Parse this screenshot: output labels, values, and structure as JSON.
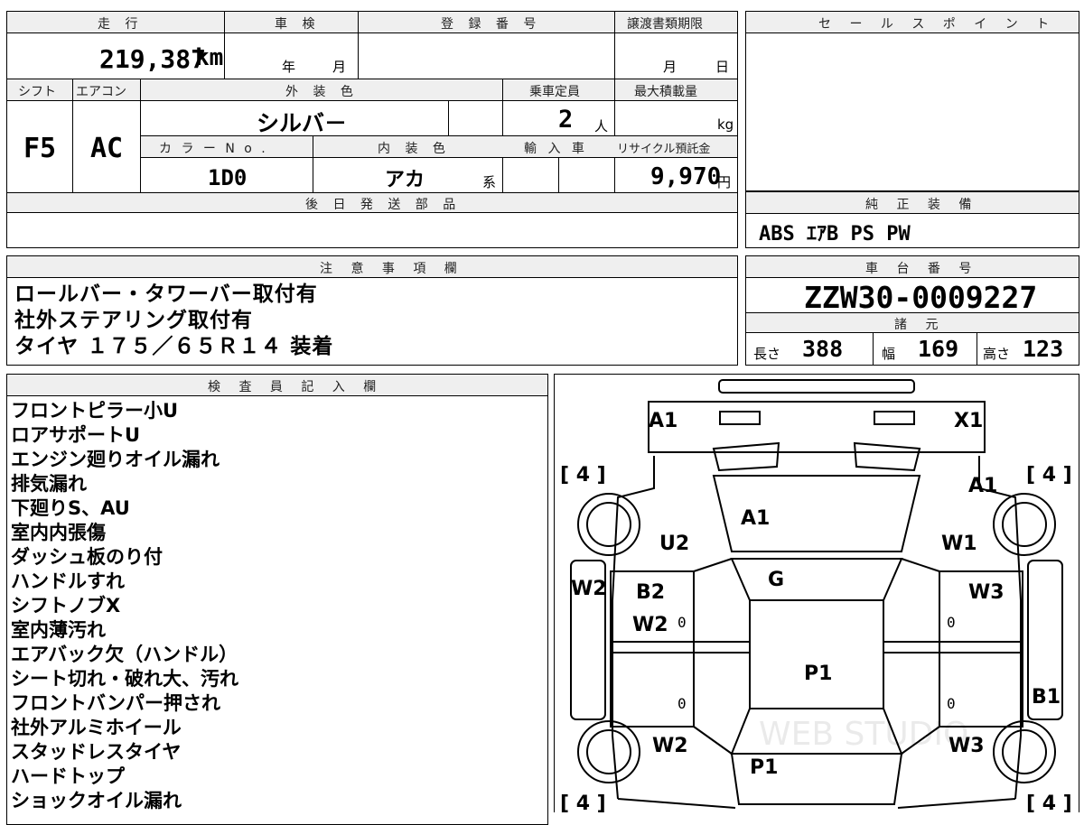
{
  "top_form": {
    "h_mileage": "走 行",
    "mileage": "219,387",
    "km_unit": "km",
    "h_inspection": "車 検",
    "year_unit": "年",
    "month_unit": "月",
    "h_registration": "登 録 番 号",
    "h_transfer": "譲渡書類期限",
    "t_month_unit": "月",
    "t_day_unit": "日",
    "h_shift": "シフト",
    "shift": "F5",
    "h_aircon": "エアコン",
    "aircon": "AC",
    "h_exterior": "外 装 色",
    "exterior": "シルバ－",
    "h_capacity": "乗車定員",
    "capacity": "2",
    "capacity_unit": "人",
    "h_maxload": "最大積載量",
    "maxload_unit": "kg",
    "h_colorno": "カ ラ ー N o .",
    "colorno": "1D0",
    "h_interior": "内 装 色",
    "interior": "アカ",
    "interior_unit": "系",
    "h_import": "輸 入 車",
    "h_recycle": "リサイクル預託金",
    "recycle": "9,970",
    "recycle_unit": "円",
    "h_later_parts": "後 日 発 送 部 品"
  },
  "sale_points": {
    "header": "セ ー ル ス ポ イ ン ト"
  },
  "genuine": {
    "header": "純 正 装 備",
    "items": "ABS ｴｱB PS PW"
  },
  "notes": {
    "header": "注 意 事 項 欄",
    "lines": [
      "ロールバー・タワーバー取付有",
      "社外ステアリング取付有",
      "タイヤ １７５／６５Ｒ１４ 装着"
    ]
  },
  "chassis": {
    "header": "車 台 番 号",
    "number": "ZZW30-0009227"
  },
  "specs": {
    "header": "諸 元",
    "length_label": "長さ",
    "length": "388",
    "width_label": "幅",
    "width": "169",
    "height_label": "高さ",
    "height": "123"
  },
  "inspector": {
    "header": "検 査 員 記 入 欄",
    "lines": [
      "フロントピラー小U",
      "ロアサポートU",
      "エンジン廻りオイル漏れ",
      "排気漏れ",
      "下廻りS、AU",
      "室内内張傷",
      "ダッシュ板のり付",
      "ハンドルすれ",
      "シフトノブX",
      "室内薄汚れ",
      "エアバック欠（ハンドル）",
      "シート切れ・破れ大、汚れ",
      "フロントバンパー押され",
      "社外アルミホイール",
      "スタッドレスタイヤ",
      "ハードトップ",
      "ショックオイル漏れ"
    ]
  },
  "diagram": {
    "tire_fl": "[ 4 ]",
    "tire_fr": "[ 4 ]",
    "tire_rl": "[ 4 ]",
    "tire_rr": "[ 4 ]",
    "front_left": "A1",
    "front_right": "X1",
    "right_headlight": "A1",
    "hood": "A1",
    "left_fender": "U2",
    "right_fender": "W1",
    "windshield": "G",
    "left_rocker": "W2",
    "left_door": "B2",
    "left_door_2": "W2",
    "right_door": "W3",
    "roof": "P1",
    "right_quarter": "B1",
    "left_rear": "W2",
    "right_rear": "W3",
    "trunk": "P1",
    "zero": "0",
    "watermark": "WEB STUDIO"
  }
}
